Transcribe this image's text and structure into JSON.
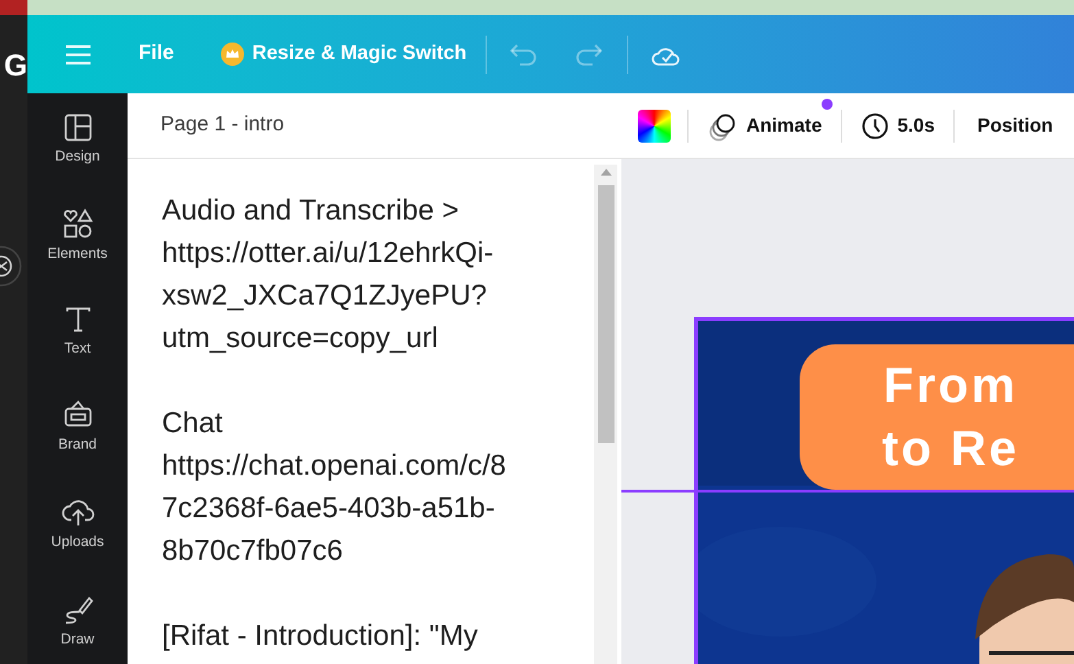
{
  "side_strip": {
    "text": "G"
  },
  "header": {
    "file": "File",
    "resize": "Resize & Magic Switch"
  },
  "sidebar": {
    "items": [
      {
        "label": "Design",
        "kind": "design"
      },
      {
        "label": "Elements",
        "kind": "elements"
      },
      {
        "label": "Text",
        "kind": "text"
      },
      {
        "label": "Brand",
        "kind": "brand"
      },
      {
        "label": "Uploads",
        "kind": "uploads"
      },
      {
        "label": "Draw",
        "kind": "draw"
      }
    ]
  },
  "notes": {
    "page_title": "Page 1 - intro",
    "paragraphs": [
      [
        "Audio and Transcribe >",
        "https://otter.ai/u/12ehrkQi-",
        "xsw2_JXCa7Q1ZJyePU?",
        "utm_source=copy_url"
      ],
      [
        "Chat",
        "https://chat.openai.com/c/8",
        "7c2368f-6ae5-403b-a51b-",
        "8b70c7fb07c6"
      ],
      [
        "[Rifat - Introduction]: \"My"
      ]
    ]
  },
  "toolbar": {
    "animate": "Animate",
    "animate_badge": true,
    "duration": "5.0s",
    "position": "Position"
  },
  "design": {
    "title_lines": [
      "From",
      "to Re"
    ]
  }
}
